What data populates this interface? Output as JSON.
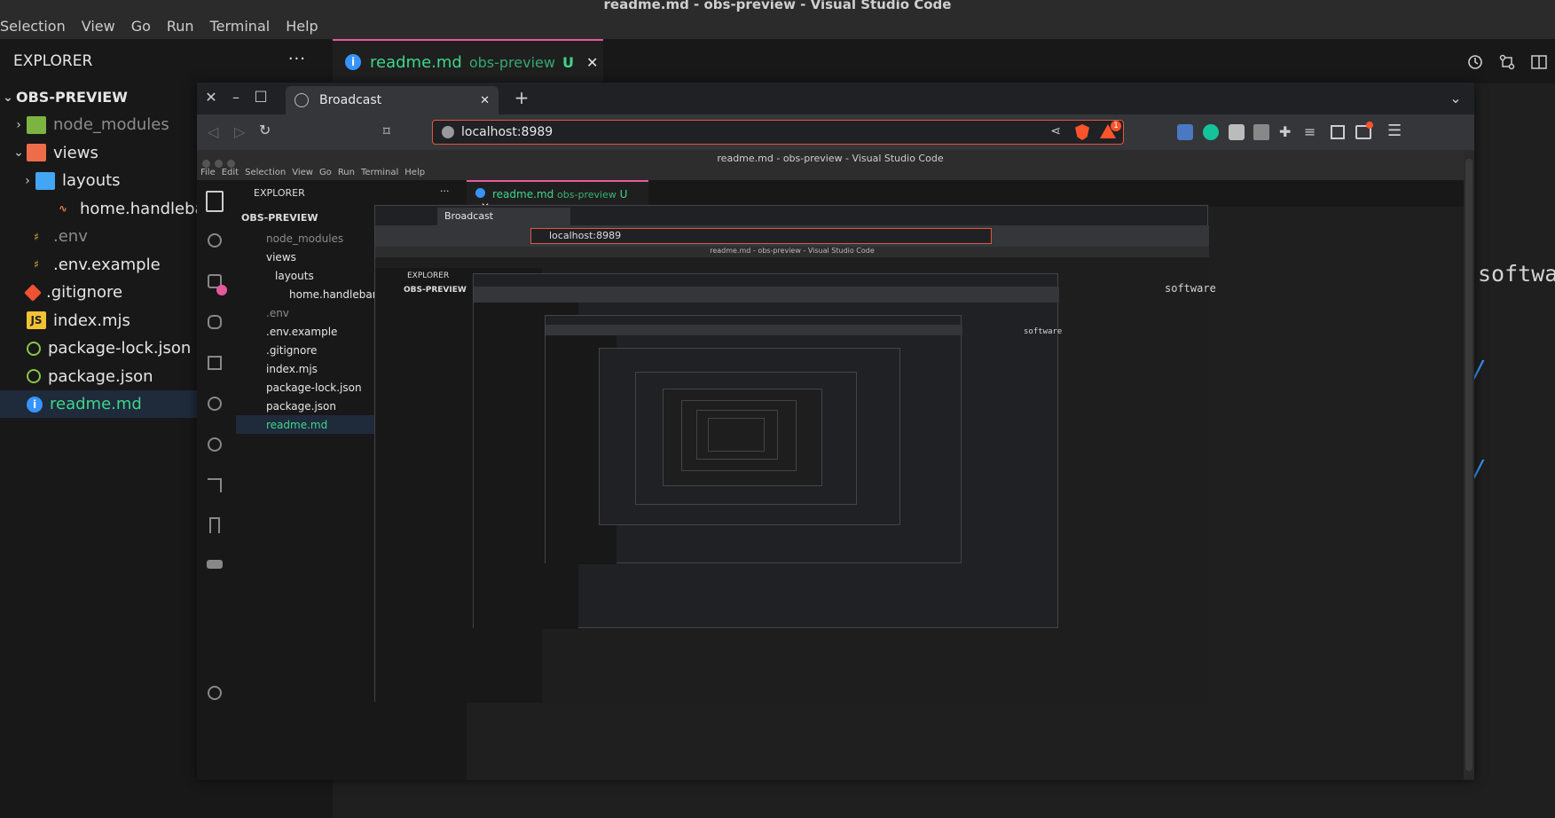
{
  "window": {
    "title": "readme.md - obs-preview - Visual Studio Code"
  },
  "menu": [
    "Selection",
    "View",
    "Go",
    "Run",
    "Terminal",
    "Help"
  ],
  "explorer": {
    "title": "EXPLORER",
    "more": "···",
    "root": "OBS-PREVIEW",
    "items": [
      {
        "label": "node_modules",
        "depth": 1,
        "chev": "›",
        "icon": "folder-node-icon",
        "color": "#8c8c8c"
      },
      {
        "label": "views",
        "depth": 1,
        "chev": "⌄",
        "icon": "folder-views-icon",
        "color": "#e6e6e6"
      },
      {
        "label": "layouts",
        "depth": 2,
        "chev": "›",
        "icon": "folder-layouts-icon",
        "color": "#e6e6e6"
      },
      {
        "label": "home.handlebars",
        "depth": 3,
        "chev": "",
        "icon": "handlebars-icon",
        "color": "#e6e6e6"
      },
      {
        "label": ".env",
        "depth": 1,
        "chev": "",
        "icon": "env-icon",
        "color": "#8c8c8c"
      },
      {
        "label": ".env.example",
        "depth": 1,
        "chev": "",
        "icon": "env-icon",
        "color": "#e6e6e6"
      },
      {
        "label": ".gitignore",
        "depth": 1,
        "chev": "",
        "icon": "git-icon",
        "color": "#e6e6e6"
      },
      {
        "label": "index.mjs",
        "depth": 1,
        "chev": "",
        "icon": "js-icon",
        "color": "#e6e6e6"
      },
      {
        "label": "package-lock.json",
        "depth": 1,
        "chev": "",
        "icon": "node-icon",
        "color": "#e6e6e6"
      },
      {
        "label": "package.json",
        "depth": 1,
        "chev": "",
        "icon": "node-icon",
        "color": "#e6e6e6"
      },
      {
        "label": "readme.md",
        "depth": 1,
        "chev": "",
        "icon": "info-icon",
        "color": "#3dd68c",
        "selected": true
      }
    ]
  },
  "editor": {
    "tab": {
      "name": "readme.md",
      "folder": "obs-preview",
      "badge": "U",
      "close": "✕"
    },
    "fragments": [
      "softwa",
      "software",
      "software",
      "software",
      "software"
    ]
  },
  "browser": {
    "tab_label": "Broadcast",
    "new_tab": "+",
    "url": "localhost:8989",
    "close": "✕",
    "minimize": "–",
    "maximize": "□",
    "menu": "☰",
    "more": "⌄",
    "badge": "1"
  },
  "inner": {
    "menu": [
      "File",
      "Edit",
      "Selection",
      "View",
      "Go",
      "Run",
      "Terminal",
      "Help"
    ]
  },
  "colors": {
    "accent": "#e65a9b",
    "selected_text": "#3dd68c",
    "link": "#3794ff",
    "brave": "#fb542b"
  }
}
